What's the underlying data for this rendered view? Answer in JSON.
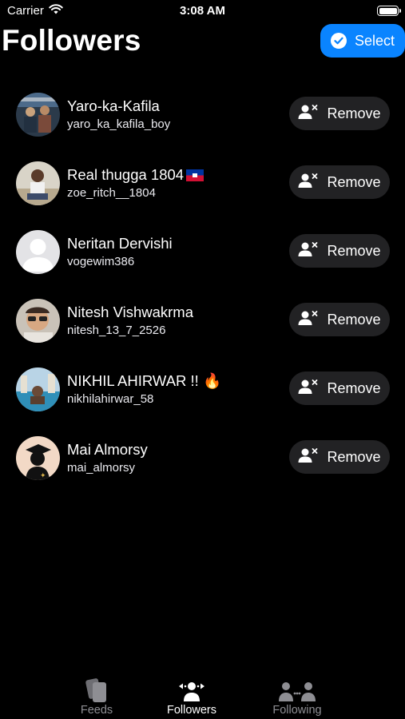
{
  "status_bar": {
    "carrier": "Carrier",
    "time": "3:08 AM"
  },
  "header": {
    "title": "Followers",
    "select_label": "Select"
  },
  "followers": [
    {
      "name": "Yaro-ka-Kafila",
      "username": "yaro_ka_kafila_boy",
      "remove_label": "Remove"
    },
    {
      "name": "Real thugga 1804",
      "username": "zoe_ritch__1804",
      "remove_label": "Remove"
    },
    {
      "name": "Neritan Dervishi",
      "username": "vogewim386",
      "remove_label": "Remove"
    },
    {
      "name": "Nitesh Vishwakrma",
      "username": "nitesh_13_7_2526",
      "remove_label": "Remove"
    },
    {
      "name": "NIKHIL AHIRWAR !! 🔥",
      "username": "nikhilahirwar_58",
      "remove_label": "Remove"
    },
    {
      "name": "Mai Almorsy",
      "username": "mai_almorsy",
      "remove_label": "Remove"
    }
  ],
  "tabs": [
    {
      "label": "Feeds",
      "icon": "feeds-icon",
      "active": false
    },
    {
      "label": "Followers",
      "icon": "followers-icon",
      "active": true
    },
    {
      "label": "Following",
      "icon": "following-icon",
      "active": false
    }
  ],
  "colors": {
    "accent": "#0a84ff",
    "button_bg": "#222224",
    "inactive_tab": "#8e8e93"
  }
}
